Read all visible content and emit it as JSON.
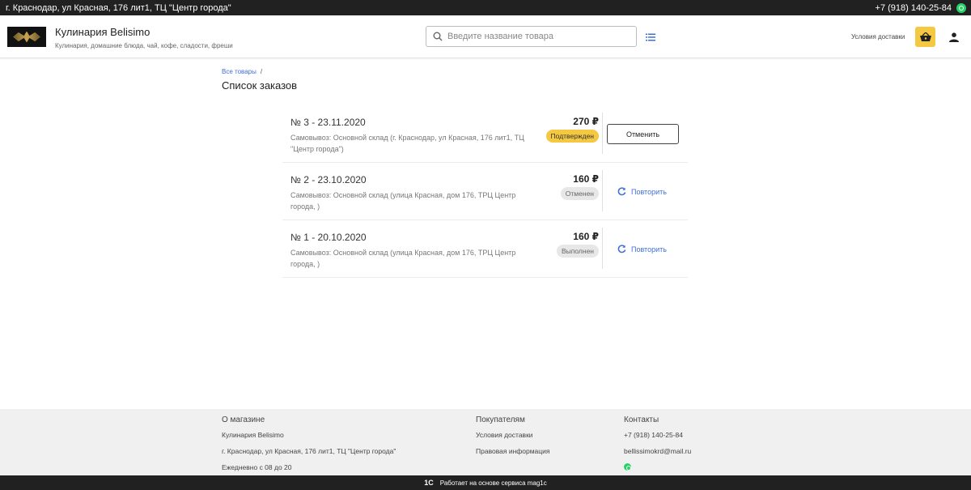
{
  "topbar": {
    "address": "г. Краснодар, ул Красная, 176 лит1, ТЦ \"Центр города\"",
    "phone": "+7 (918) 140-25-84"
  },
  "header": {
    "brand_name": "Кулинария Belisimo",
    "brand_sub": "Кулинария, домашние блюда, чай, кофе, сладости, фреши",
    "search_placeholder": "Введите название товара",
    "delivery_link": "Условия доставки"
  },
  "breadcrumb": {
    "all_products": "Все товары",
    "separator": "/"
  },
  "page_title": "Список заказов",
  "orders": [
    {
      "title": "№ 3 - 23.11.2020",
      "address": "Самовывоз: Основной склад (г. Краснодар, ул Красная, 176 лит1, ТЦ \"Центр города\")",
      "price": "270 ₽",
      "status": "Подтвержден",
      "action": "Отменить"
    },
    {
      "title": "№ 2 - 23.10.2020",
      "address": "Самовывоз: Основной склад (улица Красная, дом 176, ТРЦ Центр города, )",
      "price": "160 ₽",
      "status": "Отменен",
      "action": "Повторить"
    },
    {
      "title": "№ 1 - 20.10.2020",
      "address": "Самовывоз: Основной склад (улица Красная, дом 176, ТРЦ Центр города, )",
      "price": "160 ₽",
      "status": "Выполнен",
      "action": "Повторить"
    }
  ],
  "footer": {
    "about": {
      "heading": "О магазине",
      "name": "Кулинария Belisimo",
      "address": "г. Краснодар, ул Красная, 176 лит1, ТЦ \"Центр города\"",
      "hours": "Ежедневно с 08 до 20"
    },
    "buyers": {
      "heading": "Покупателям",
      "delivery": "Условия доставки",
      "legal": "Правовая информация"
    },
    "contacts": {
      "heading": "Контакты",
      "phone": "+7 (918) 140-25-84",
      "email": "bellissimokrd@mail.ru"
    }
  },
  "bottombar": {
    "logo": "1С",
    "text": "Работает на основе сервиса mag1c"
  },
  "colors": {
    "accent": "#f5c842",
    "link": "#3d6fd8",
    "dark_bar": "#212121"
  }
}
